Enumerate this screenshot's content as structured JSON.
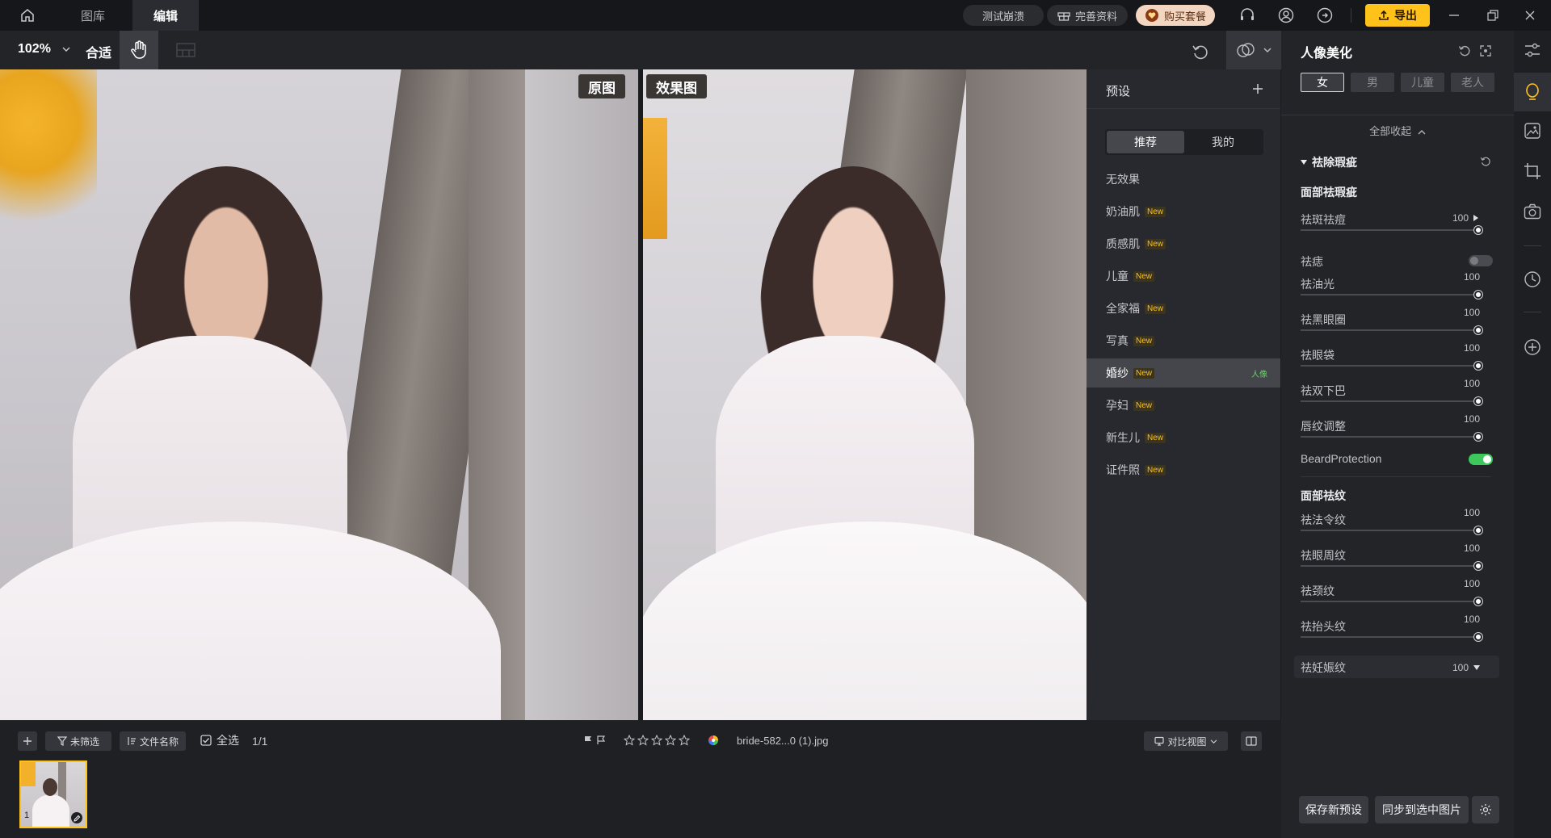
{
  "titlebar": {
    "tabs": [
      "图库",
      "编辑"
    ],
    "active_tab": "编辑",
    "pill_test": "测试崩溃",
    "pill_profile": "完善资料",
    "pill_buy": "购买套餐",
    "export_label": "导出",
    "icons": [
      "home-icon",
      "headset-icon",
      "user-icon",
      "share-icon",
      "minimize-icon",
      "restore-icon",
      "close-icon"
    ]
  },
  "toolbar": {
    "zoom": "102%",
    "fit": "合适"
  },
  "canvas": {
    "original_label": "原图",
    "result_label": "效果图"
  },
  "presets": {
    "header": "预设",
    "segments": [
      "推荐",
      "我的"
    ],
    "active_segment": "推荐",
    "new_badge": "New",
    "items": [
      {
        "label": "无效果",
        "new": false
      },
      {
        "label": "奶油肌",
        "new": true
      },
      {
        "label": "质感肌",
        "new": true
      },
      {
        "label": "儿童",
        "new": true
      },
      {
        "label": "全家福",
        "new": true
      },
      {
        "label": "写真",
        "new": true
      },
      {
        "label": "婚纱",
        "new": true,
        "active": true,
        "tag": "人像"
      },
      {
        "label": "孕妇",
        "new": true
      },
      {
        "label": "新生儿",
        "new": true
      },
      {
        "label": "证件照",
        "new": true
      }
    ]
  },
  "adjust": {
    "title": "人像美化",
    "genders": [
      "女",
      "男",
      "儿童",
      "老人"
    ],
    "active_gender": "女",
    "collapse_all": "全部收起",
    "group_title": "祛除瑕疵",
    "section1": "面部祛瑕疵",
    "rows1": [
      {
        "label": "祛斑祛痘",
        "value": "100"
      },
      {
        "label": "祛痣",
        "toggle": false
      },
      {
        "label": "祛油光",
        "value": "100"
      },
      {
        "label": "祛黑眼圈",
        "value": "100"
      },
      {
        "label": "祛眼袋",
        "value": "100"
      },
      {
        "label": "祛双下巴",
        "value": "100"
      },
      {
        "label": "唇纹调整",
        "value": "100"
      },
      {
        "label": "BeardProtection",
        "toggle": true
      }
    ],
    "section2": "面部祛纹",
    "rows2": [
      {
        "label": "祛法令纹",
        "value": "100"
      },
      {
        "label": "祛眼周纹",
        "value": "100"
      },
      {
        "label": "祛颈纹",
        "value": "100"
      },
      {
        "label": "祛抬头纹",
        "value": "100"
      }
    ],
    "partial_row": {
      "label": "祛妊娠纹",
      "value": "100"
    },
    "save_preset": "保存新预设",
    "sync": "同步到选中图片"
  },
  "bottom": {
    "filter": "未筛选",
    "sort": "文件名称",
    "select_all": "全选",
    "count": "1/1",
    "filename": "bride-582...0 (1).jpg",
    "compare_view": "对比视图",
    "thumb_index": "1"
  },
  "colors": {
    "accent": "#ffc21a",
    "toggle_on": "#3cc85a",
    "panel": "#232428"
  }
}
